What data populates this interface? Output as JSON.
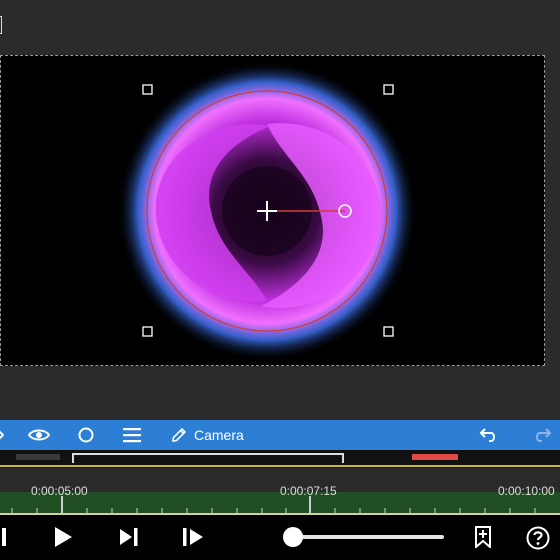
{
  "toolbar": {
    "camera_label": "Camera"
  },
  "timeline": {
    "ticks": [
      "0:00:05:00",
      "0:00:07:15",
      "0:00:10:00"
    ]
  },
  "playback": {
    "position_fraction": 0.0
  },
  "icons": {
    "top_handle": "resize-handle-icon",
    "visibility": "eye-icon",
    "shape": "circle-icon",
    "menu": "menu-icon",
    "edit": "pencil-icon",
    "undo": "undo-icon",
    "redo": "redo-icon",
    "skip_start": "skip-start-icon",
    "play": "play-icon",
    "next_frame": "next-frame-icon",
    "play_from": "play-from-icon",
    "bookmark": "bookmark-icon",
    "help": "help-icon"
  },
  "colors": {
    "toolbar": "#2d7fd6",
    "accent_red": "#e24a4a",
    "track": "#1f4f22",
    "effect_magenta": "#e040ff"
  }
}
